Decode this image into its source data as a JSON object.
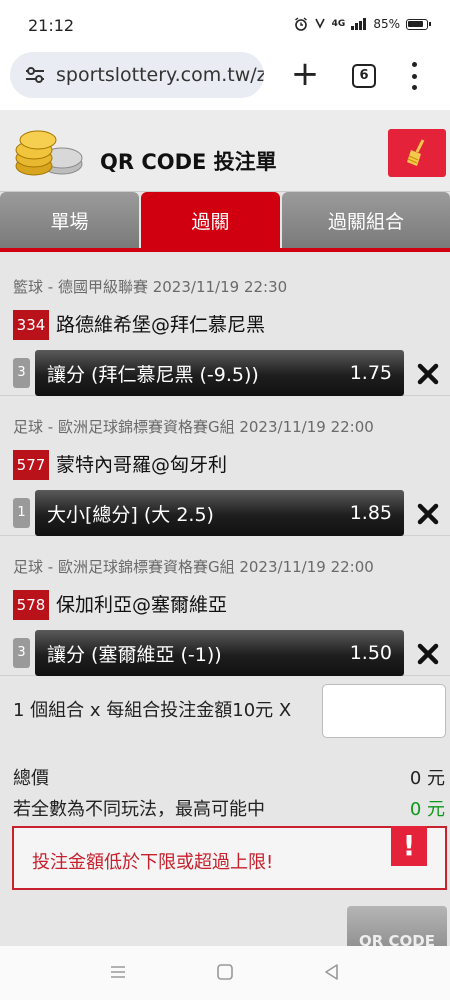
{
  "status_bar": {
    "time": "21:12",
    "network": "4G",
    "battery": "85%"
  },
  "browser": {
    "url": "sportslottery.com.tw/zh",
    "tab_count": "6"
  },
  "page": {
    "title": "QR CODE 投注單",
    "tabs": [
      {
        "label": "單場",
        "active": false
      },
      {
        "label": "過關",
        "active": true
      },
      {
        "label": "過關組合",
        "active": false
      }
    ],
    "bets": [
      {
        "meta": "籃球 - 德國甲級聯賽 2023/11/19 22:30",
        "code": "334",
        "match": "路德維希堡@拜仁慕尼黑",
        "num": "3",
        "pick": "讓分 (拜仁慕尼黑 (-9.5))",
        "odds": "1.75"
      },
      {
        "meta": "足球 - 歐洲足球錦標賽資格賽G組 2023/11/19 22:00",
        "code": "577",
        "match": "蒙特內哥羅@匈牙利",
        "num": "1",
        "pick": "大小[總分] (大 2.5)",
        "odds": "1.85"
      },
      {
        "meta": "足球 - 歐洲足球錦標賽資格賽G組 2023/11/19 22:00",
        "code": "578",
        "match": "保加利亞@塞爾維亞",
        "num": "3",
        "pick": "讓分 (塞爾維亞 (-1))",
        "odds": "1.50"
      }
    ],
    "summary": {
      "combo_text": "1 個組合 x 每組合投注金額10元 X",
      "amount_value": "",
      "total_label": "總價",
      "total_value": "0 元",
      "max_label": "若全數為不同玩法，最高可能中",
      "max_value": "0 元"
    },
    "alert": {
      "message": "投注金額低於下限或超過上限!",
      "icon": "!"
    },
    "qr_button": "QR CODE"
  },
  "colors": {
    "accent_red": "#d00010",
    "code_red": "#b9121b",
    "win_green": "#0a9a1a"
  }
}
